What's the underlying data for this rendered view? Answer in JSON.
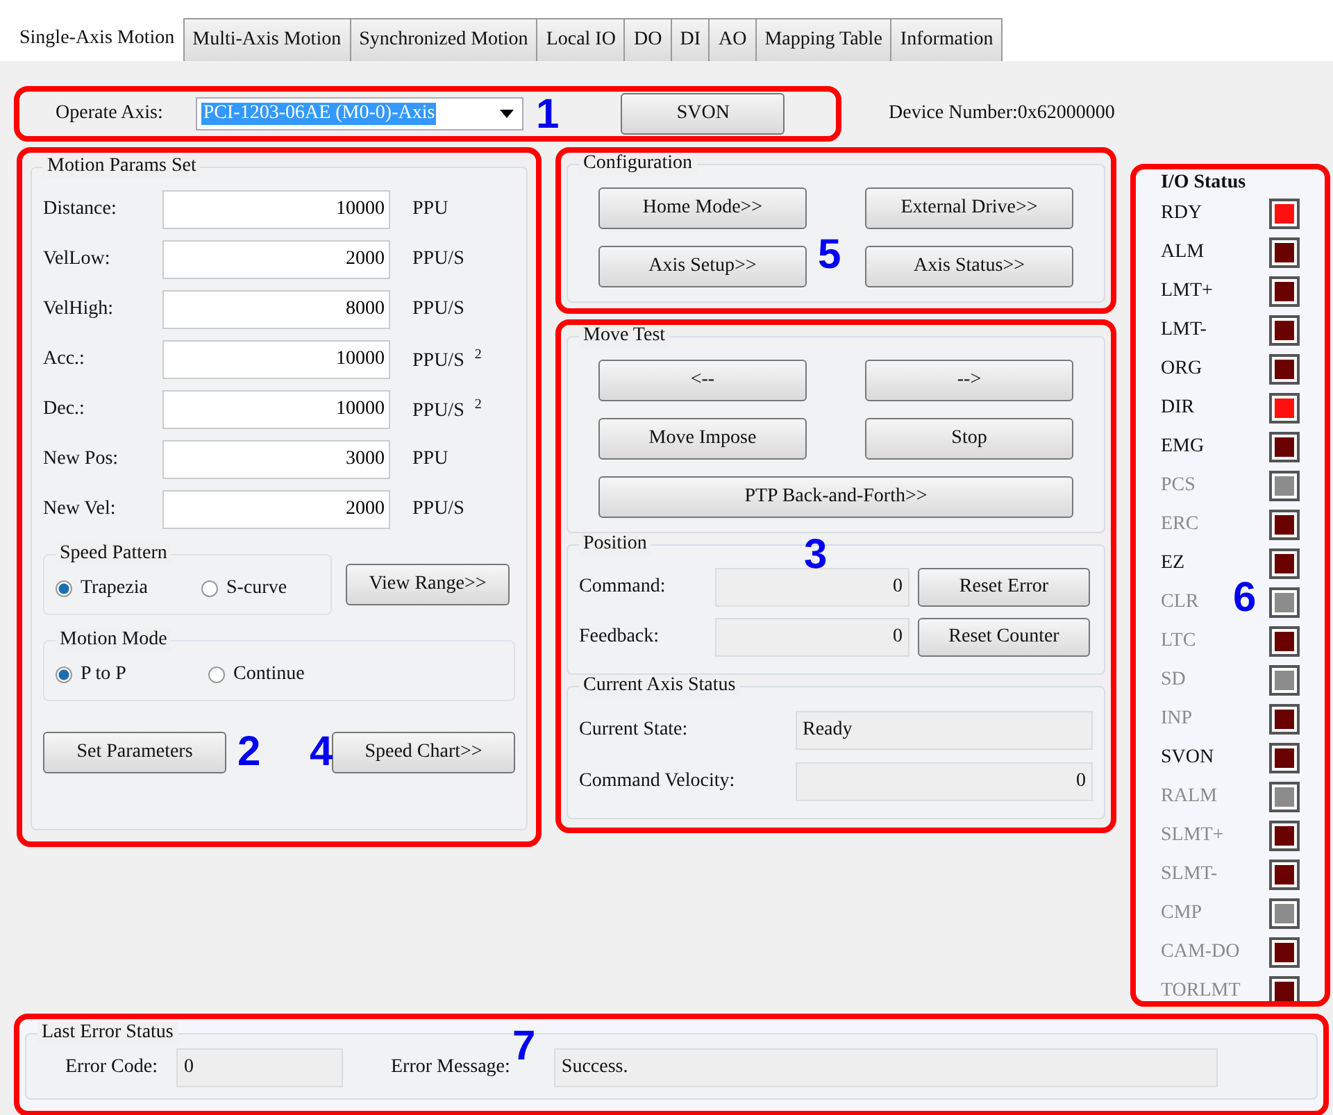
{
  "tabs": [
    {
      "label": "Single-Axis Motion",
      "selected": true
    },
    {
      "label": "Multi-Axis Motion",
      "selected": false
    },
    {
      "label": "Synchronized Motion",
      "selected": false
    },
    {
      "label": "Local IO",
      "selected": false
    },
    {
      "label": "DO",
      "selected": false
    },
    {
      "label": "DI",
      "selected": false
    },
    {
      "label": "AO",
      "selected": false
    },
    {
      "label": "Mapping Table",
      "selected": false
    },
    {
      "label": "Information",
      "selected": false
    }
  ],
  "axis_bar": {
    "callout": "1",
    "label": "Operate Axis:",
    "value": "PCI-1203-06AE (M0-0)-Axis",
    "button": "SVON",
    "device_number": "Device Number:0x62000000"
  },
  "motion_params": {
    "callout": "2",
    "title": "Motion Params Set",
    "rows": [
      {
        "label": "Distance:",
        "value": "10000",
        "unit": "PPU"
      },
      {
        "label": "VelLow:",
        "value": "2000",
        "unit": "PPU/S"
      },
      {
        "label": "VelHigh:",
        "value": "8000",
        "unit": "PPU/S"
      },
      {
        "label": "Acc.:",
        "value": "10000",
        "unit": "PPU/S $^{2}$"
      },
      {
        "label": "Dec.:",
        "value": "10000",
        "unit": "PPU/S $^{2}$"
      },
      {
        "label": "New Pos:",
        "value": "3000",
        "unit": "PPU"
      },
      {
        "label": "New Vel:",
        "value": "2000",
        "unit": "PPU/S"
      }
    ],
    "speed_pattern": {
      "title": "Speed Pattern",
      "options": [
        {
          "label": "Trapezia",
          "selected": true
        },
        {
          "label": "S-curve",
          "selected": false
        }
      ]
    },
    "view_range_button": "View Range>>",
    "motion_mode": {
      "title": "Motion Mode",
      "options": [
        {
          "label": "P to P",
          "selected": true
        },
        {
          "label": "Continue",
          "selected": false
        }
      ]
    },
    "set_button": "Set Parameters",
    "chart_button": "Speed Chart>>",
    "chart_callout": "4"
  },
  "configuration": {
    "callout": "5",
    "title": "Configuration",
    "buttons": [
      "Home Mode>>",
      "External Drive>>",
      "Axis Setup>>",
      "Axis Status>>"
    ]
  },
  "move_test": {
    "callout": "3",
    "title": "Move Test",
    "buttons": [
      "<--",
      "-->",
      "Move Impose",
      "Stop"
    ],
    "wide_button": "PTP Back-and-Forth>>",
    "position": {
      "title": "Position",
      "rows": [
        {
          "label": "Command:",
          "value": "0",
          "button": "Reset Error"
        },
        {
          "label": "Feedback:",
          "value": "0",
          "button": "Reset Counter"
        }
      ]
    },
    "axis_status": {
      "title": "Current Axis Status",
      "state_label": "Current State:",
      "state": "Ready",
      "velocity_label": "Command Velocity:",
      "velocity": "0"
    }
  },
  "io_status": {
    "callout": "6",
    "title": "I/O Status",
    "signals": [
      {
        "name": "RDY",
        "disabled": false,
        "kind": "active",
        "on": true
      },
      {
        "name": "ALM",
        "disabled": false,
        "kind": "active",
        "on": false
      },
      {
        "name": "LMT+",
        "disabled": false,
        "kind": "active",
        "on": false
      },
      {
        "name": "LMT-",
        "disabled": false,
        "kind": "active",
        "on": false
      },
      {
        "name": "ORG",
        "disabled": false,
        "kind": "active",
        "on": false
      },
      {
        "name": "DIR",
        "disabled": false,
        "kind": "active",
        "on": true
      },
      {
        "name": "EMG",
        "disabled": false,
        "kind": "active",
        "on": false
      },
      {
        "name": "PCS",
        "disabled": true,
        "kind": "inactive",
        "on": false
      },
      {
        "name": "ERC",
        "disabled": true,
        "kind": "active",
        "on": false
      },
      {
        "name": "EZ",
        "disabled": false,
        "kind": "active",
        "on": false
      },
      {
        "name": "CLR",
        "disabled": true,
        "kind": "inactive",
        "on": false
      },
      {
        "name": "LTC",
        "disabled": true,
        "kind": "active",
        "on": false
      },
      {
        "name": "SD",
        "disabled": true,
        "kind": "inactive",
        "on": false
      },
      {
        "name": "INP",
        "disabled": true,
        "kind": "active",
        "on": false
      },
      {
        "name": "SVON",
        "disabled": false,
        "kind": "active",
        "on": false
      },
      {
        "name": "RALM",
        "disabled": true,
        "kind": "inactive",
        "on": false
      },
      {
        "name": "SLMT+",
        "disabled": true,
        "kind": "active",
        "on": false
      },
      {
        "name": "SLMT-",
        "disabled": true,
        "kind": "active",
        "on": false
      },
      {
        "name": "CMP",
        "disabled": true,
        "kind": "inactive",
        "on": false
      },
      {
        "name": "CAM-DO",
        "disabled": true,
        "kind": "active",
        "on": false
      },
      {
        "name": "TORLMT",
        "disabled": true,
        "kind": "active",
        "on": false
      }
    ]
  },
  "last_error": {
    "callout": "7",
    "title": "Last Error Status",
    "code_label": "Error Code:",
    "code": "0",
    "message_label": "Error Message:",
    "message": "Success."
  }
}
